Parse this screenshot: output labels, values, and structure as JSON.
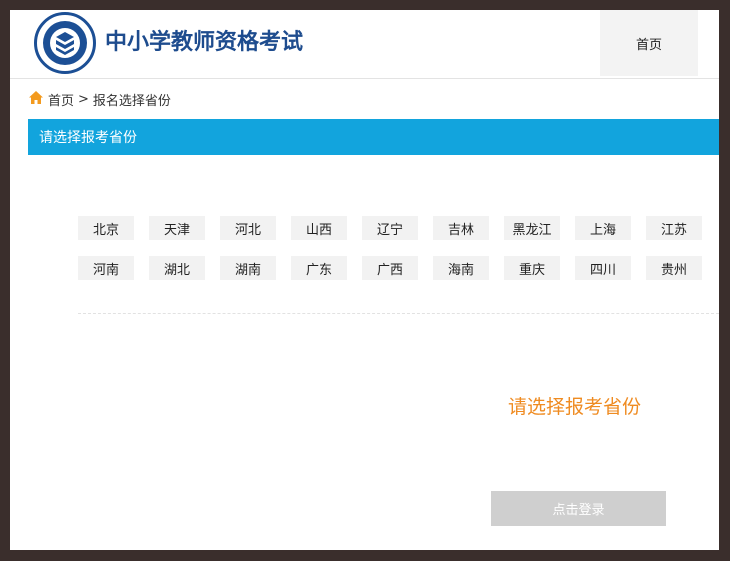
{
  "header": {
    "site_title": "中小学教师资格考试",
    "home_nav_label": "首页"
  },
  "breadcrumb": {
    "home": "首页",
    "separator": ">",
    "current": "报名选择省份"
  },
  "section": {
    "title": "请选择报考省份"
  },
  "provinces": [
    [
      "北京",
      "天津",
      "河北",
      "山西",
      "辽宁",
      "吉林",
      "黑龙江",
      "上海",
      "江苏"
    ],
    [
      "河南",
      "湖北",
      "湖南",
      "广东",
      "广西",
      "海南",
      "重庆",
      "四川",
      "贵州"
    ]
  ],
  "prompt": "请选择报考省份",
  "login_button_label": "点击登录",
  "colors": {
    "accent_bar": "#12a4dd",
    "prompt_orange": "#ef8b21",
    "title_blue": "#1e4c8e",
    "button_disabled": "#cfcfcf"
  },
  "icons": {
    "logo": "book-seal-logo",
    "breadcrumb_home": "home-icon"
  }
}
